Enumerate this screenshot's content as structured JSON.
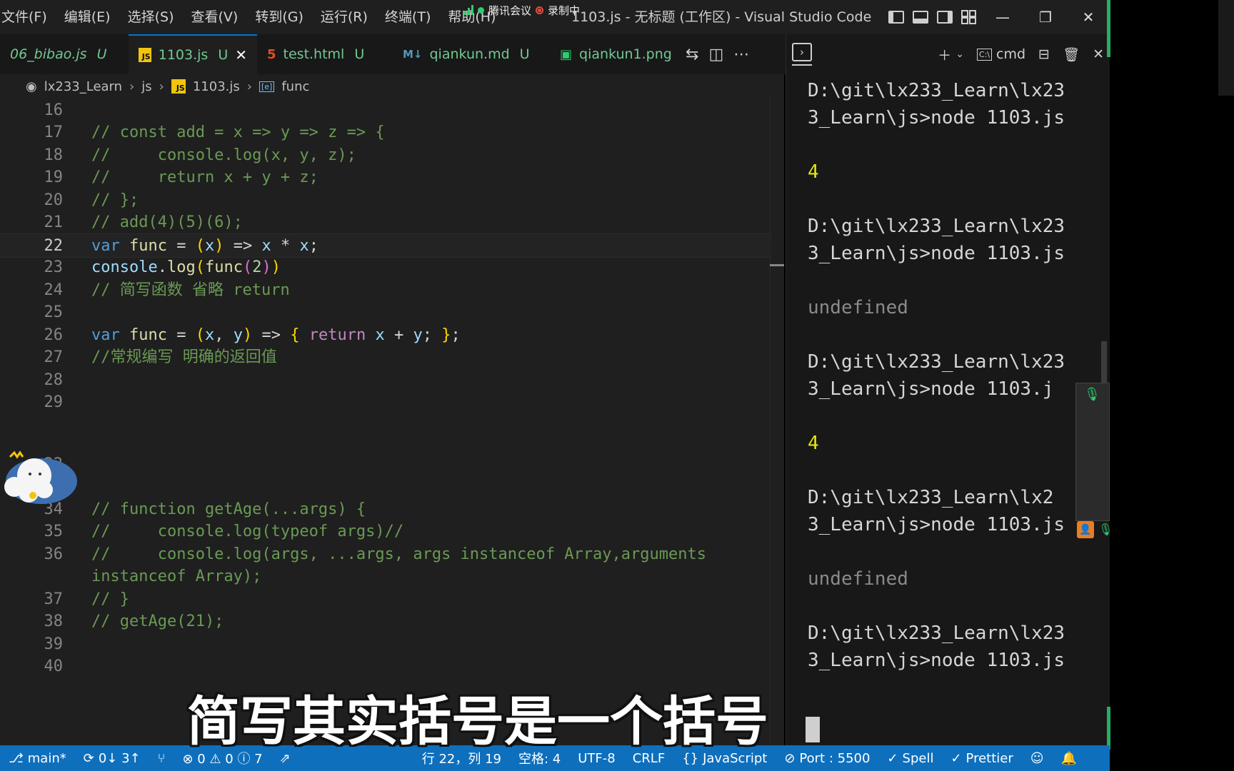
{
  "menu": [
    "文件(F)",
    "编辑(E)",
    "选择(S)",
    "查看(V)",
    "转到(G)",
    "运行(R)",
    "终端(T)",
    "帮助(H)"
  ],
  "window_title": "1103.js - 无标题 (工作区) - Visual Studio Code",
  "meeting": {
    "app": "腾讯会议",
    "recording": "录制中"
  },
  "tabs": [
    {
      "label": "06_bibao.js",
      "status": "U",
      "icon": "js-icon"
    },
    {
      "label": "1103.js",
      "status": "U",
      "icon": "js-icon",
      "active": true
    },
    {
      "label": "test.html",
      "status": "U",
      "icon": "html5-icon"
    },
    {
      "label": "qiankun.md",
      "status": "U",
      "icon": "markdown-icon"
    },
    {
      "label": "qiankun1.png",
      "status": "",
      "icon": "image-icon"
    }
  ],
  "breadcrumb": {
    "root": "lx233_Learn",
    "folder": "js",
    "file": "1103.js",
    "symbol": "func"
  },
  "editor": {
    "lines": [
      {
        "n": "16",
        "text": ""
      },
      {
        "n": "17",
        "text": "// const add = x => y => z => {"
      },
      {
        "n": "18",
        "text": "//     console.log(x, y, z);"
      },
      {
        "n": "19",
        "text": "//     return x + y + z;"
      },
      {
        "n": "20",
        "text": "// };"
      },
      {
        "n": "21",
        "text": "// add(4)(5)(6);"
      },
      {
        "n": "22",
        "text": "var func = (x) => x * x;"
      },
      {
        "n": "23",
        "text": "console.log(func(2))"
      },
      {
        "n": "24",
        "text": "// 简写函数 省略 return"
      },
      {
        "n": "25",
        "text": ""
      },
      {
        "n": "26",
        "text": "var func = (x, y) => { return x + y; };"
      },
      {
        "n": "27",
        "text": "//常规编写 明确的返回值"
      },
      {
        "n": "28",
        "text": ""
      },
      {
        "n": "29",
        "text": ""
      },
      {
        "n": "32",
        "text": ""
      },
      {
        "n": "33",
        "text": ""
      },
      {
        "n": "34",
        "text": "// function getAge(...args) {"
      },
      {
        "n": "35",
        "text": "//     console.log(typeof args)//"
      },
      {
        "n": "36",
        "text": "//     console.log(args, ...args, args instanceof Array,arguments"
      },
      {
        "n": "",
        "text": "instanceof Array);"
      },
      {
        "n": "37",
        "text": "// }"
      },
      {
        "n": "38",
        "text": "// getAge(21);"
      },
      {
        "n": "39",
        "text": ""
      },
      {
        "n": "40",
        "text": ""
      }
    ]
  },
  "terminal": {
    "tab_label": "cmd",
    "output": [
      "D:\\git\\lx233_Learn\\lx23",
      "3_Learn\\js>node 1103.js",
      "",
      "4",
      "",
      "D:\\git\\lx233_Learn\\lx23",
      "3_Learn\\js>node 1103.js",
      "",
      "undefined",
      "",
      "D:\\git\\lx233_Learn\\lx23",
      "3_Learn\\js>node 1103.j",
      "",
      "4",
      "",
      "D:\\git\\lx233_Learn\\lx2",
      "3_Learn\\js>node 1103.js",
      "",
      "undefined",
      "",
      "D:\\git\\lx233_Learn\\lx23",
      "3_Learn\\js>node 1103.js"
    ]
  },
  "statusbar": {
    "branch": "main*",
    "sync": "0↓ 3↑",
    "problems": "⊗ 0 ⚠ 0 ⓘ 7",
    "position": "行 22，列 19",
    "spaces": "空格: 4",
    "encoding": "UTF-8",
    "eol": "CRLF",
    "language": "JavaScript",
    "port": "Port : 5500",
    "spell": "Spell",
    "prettier": "Prettier"
  },
  "subtitle": "简写其实括号是一个括号",
  "colors": {
    "accent": "#0078d4",
    "statusbar": "#0e6fbd",
    "comment": "#6a9955",
    "keyword": "#569cd6",
    "terminal_number": "#e5e510"
  }
}
